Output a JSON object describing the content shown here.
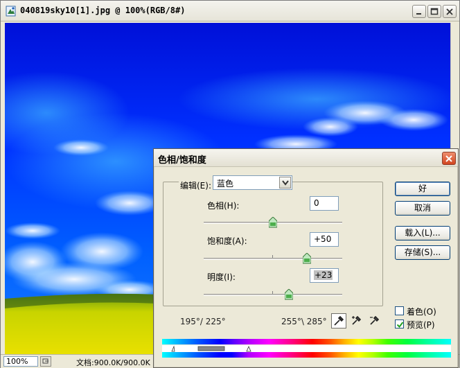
{
  "document": {
    "title": "040819sky10[1].jpg @ 100%(RGB/8#)",
    "zoom": "100%",
    "info": "文档:900.0K/900.0K"
  },
  "dialog": {
    "title": "色相/饱和度",
    "edit_label": "编辑(E):",
    "edit_value": "蓝色",
    "hue": {
      "label": "色相(H):",
      "value": "0"
    },
    "saturation": {
      "label": "饱和度(A):",
      "value": "+50"
    },
    "lightness": {
      "label": "明度(I):",
      "value": "+23"
    },
    "buttons": {
      "ok": "好",
      "cancel": "取消",
      "load": "载入(L)...",
      "save": "存储(S)..."
    },
    "colorize": {
      "label": "着色(O)",
      "checked": false
    },
    "preview": {
      "label": "预览(P)",
      "checked": true
    },
    "range_left": "195°/ 225°",
    "range_right": "255°\\ 285°"
  },
  "colors": {
    "sky_top": "#0018e6",
    "sky_mid": "#0054ff",
    "field": "#d8e000"
  },
  "icons": [
    "photoshop-doc-icon",
    "minimize-icon",
    "maximize-icon",
    "close-icon",
    "chevron-down-icon",
    "eyedropper-icon",
    "eyedropper-plus-icon",
    "eyedropper-minus-icon",
    "checkmark-icon"
  ]
}
